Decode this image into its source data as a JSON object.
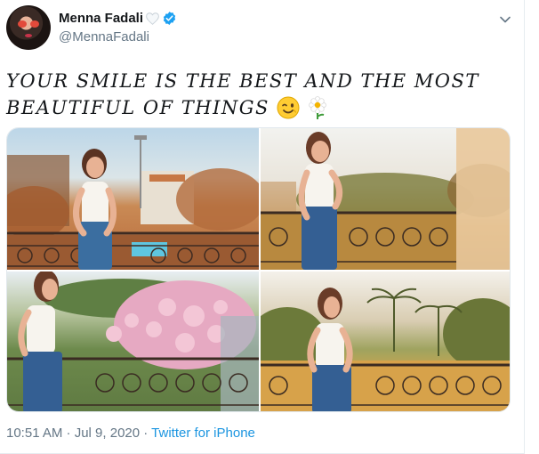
{
  "tweet": {
    "author": {
      "display_name": "Menna Fadali",
      "handle": "@MennaFadali",
      "verified": true
    },
    "text": "YOUR SMILE IS THE BEST AND THE MOST BEAUTIFUL OF THINGS",
    "emojis": [
      "winking-face-emoji",
      "flower-emoji"
    ],
    "media_count": 4,
    "timestamp": "10:51 AM · Jul 9, 2020",
    "separator": " · ",
    "source": "Twitter for iPhone"
  },
  "colors": {
    "text_primary": "#14171a",
    "text_secondary": "#657786",
    "link": "#1b95e0",
    "verified": "#1da1f2"
  },
  "icons": {
    "caret": "chevron-down-icon",
    "verified": "verified-badge-icon",
    "heart": "white-heart-icon"
  }
}
